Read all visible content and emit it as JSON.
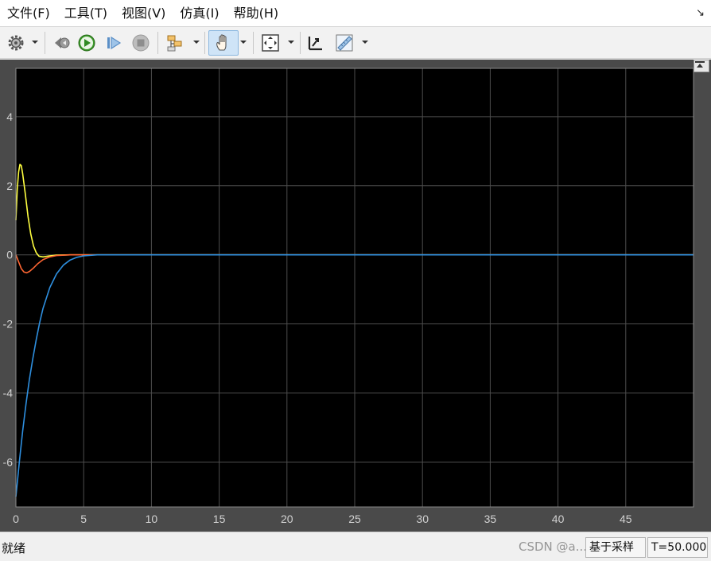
{
  "menu": {
    "items": [
      "文件(F)",
      "工具(T)",
      "视图(V)",
      "仿真(I)",
      "帮助(H)"
    ],
    "collapse_glyph": "↘"
  },
  "toolbar": {
    "buttons": [
      {
        "name": "settings-icon",
        "dropdown": true
      },
      {
        "name": "step-back-icon"
      },
      {
        "name": "run-icon"
      },
      {
        "name": "step-forward-icon"
      },
      {
        "name": "stop-icon"
      },
      {
        "name": "highlight-block-icon",
        "dropdown": true
      },
      {
        "name": "pan-hand-icon",
        "dropdown": true,
        "active": true
      },
      {
        "name": "zoom-fit-icon",
        "dropdown": true
      },
      {
        "name": "scale-axes-icon"
      },
      {
        "name": "measurement-ruler-icon",
        "dropdown": true
      }
    ]
  },
  "chart_data": {
    "type": "line",
    "xlim": [
      0,
      50
    ],
    "ylim": [
      -7.3,
      5.4
    ],
    "xticks": [
      "0",
      "5",
      "10",
      "15",
      "20",
      "25",
      "30",
      "35",
      "40",
      "45"
    ],
    "yticks": [
      "4",
      "2",
      "0",
      "-2",
      "-4",
      "-6"
    ],
    "grid": true,
    "background": "#000000",
    "series": [
      {
        "color": "#ffff40",
        "points": [
          [
            0,
            1.0
          ],
          [
            0.1,
            1.9
          ],
          [
            0.2,
            2.4
          ],
          [
            0.3,
            2.62
          ],
          [
            0.4,
            2.58
          ],
          [
            0.5,
            2.35
          ],
          [
            0.7,
            1.75
          ],
          [
            0.9,
            1.1
          ],
          [
            1.1,
            0.6
          ],
          [
            1.3,
            0.25
          ],
          [
            1.5,
            0.06
          ],
          [
            1.7,
            -0.04
          ],
          [
            2.0,
            -0.06
          ],
          [
            2.5,
            -0.03
          ],
          [
            3.0,
            -0.01
          ],
          [
            4.0,
            0
          ],
          [
            5.0,
            0
          ],
          [
            50,
            0
          ]
        ]
      },
      {
        "color": "#ff6633",
        "points": [
          [
            0,
            0.0
          ],
          [
            0.2,
            -0.2
          ],
          [
            0.4,
            -0.4
          ],
          [
            0.6,
            -0.5
          ],
          [
            0.8,
            -0.52
          ],
          [
            1.0,
            -0.48
          ],
          [
            1.3,
            -0.38
          ],
          [
            1.6,
            -0.26
          ],
          [
            2.0,
            -0.14
          ],
          [
            2.5,
            -0.06
          ],
          [
            3.0,
            -0.02
          ],
          [
            4.0,
            0
          ],
          [
            5.0,
            0
          ],
          [
            50,
            0
          ]
        ]
      },
      {
        "color": "#2e8fdf",
        "points": [
          [
            0,
            -7.0
          ],
          [
            0.25,
            -6.0
          ],
          [
            0.5,
            -5.1
          ],
          [
            0.75,
            -4.3
          ],
          [
            1.0,
            -3.6
          ],
          [
            1.25,
            -3.0
          ],
          [
            1.5,
            -2.45
          ],
          [
            1.75,
            -1.97
          ],
          [
            2.0,
            -1.55
          ],
          [
            2.5,
            -0.95
          ],
          [
            3.0,
            -0.55
          ],
          [
            3.5,
            -0.3
          ],
          [
            4.0,
            -0.15
          ],
          [
            4.5,
            -0.07
          ],
          [
            5.0,
            -0.03
          ],
          [
            6.0,
            0
          ],
          [
            50,
            0
          ]
        ]
      }
    ]
  },
  "status": {
    "ready": "就绪",
    "sample_mode": "基于采样",
    "time": "T=50.000",
    "watermark": "CSDN @a..."
  }
}
